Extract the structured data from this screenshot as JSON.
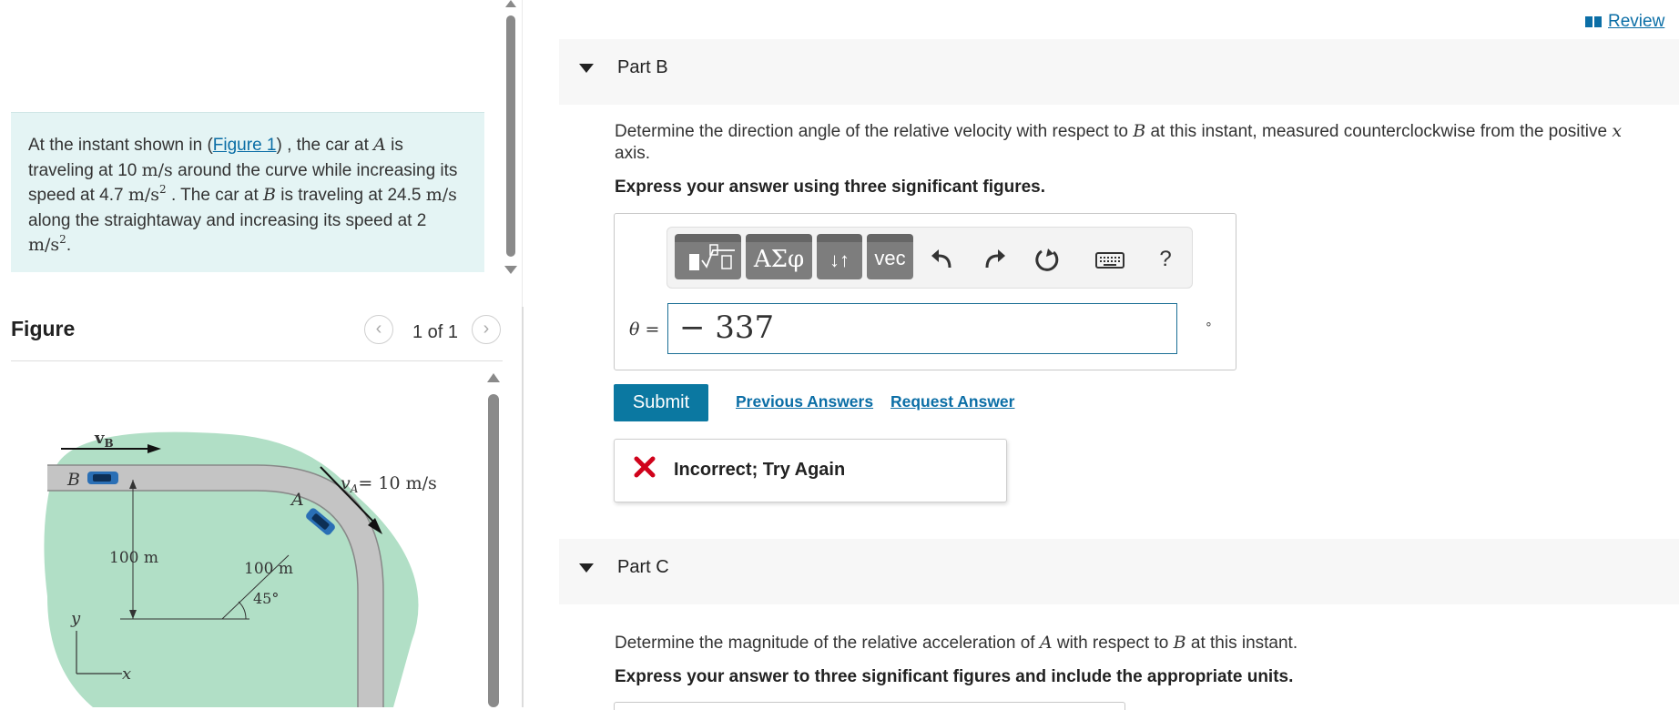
{
  "problem": {
    "seg1": "At the instant shown in (",
    "figure_link": "Figure 1",
    "seg2": ") , the car at ",
    "A": "A",
    "seg3": " is traveling at 10 ",
    "unit_ms": "m/s",
    "seg4": " around the curve while increasing its speed at 4.7 ",
    "unit_ms2": "m/s",
    "exp2": "2",
    "seg5": " . The car at ",
    "B": "B",
    "seg6": " is traveling at 24.5 ",
    "seg7": " along the straightaway and increasing its speed at 2 ",
    "seg8": "."
  },
  "figure": {
    "title": "Figure",
    "counter": "1 of 1",
    "prev_icon": "chevron-left-icon",
    "next_icon": "chevron-right-icon",
    "labels": {
      "vB": "v",
      "vB_sub": "B",
      "B": "B",
      "A": "A",
      "vA_eq": "v",
      "vA_sub": "A",
      "vA_value": "= 10 m/s",
      "dist1": "100 m",
      "dist2": "100 m",
      "angle": "45°",
      "y_axis": "y",
      "x_axis": "x"
    },
    "colors": {
      "shade": "#a8dcc0",
      "road": "#cfcfcf",
      "car": "#2a6fb5"
    }
  },
  "header": {
    "review_label": "Review",
    "review_icon": "book-icon"
  },
  "partB": {
    "title": "Part B",
    "question_pre": "Determine the direction angle of the relative velocity with respect to ",
    "question_B": "B",
    "question_post": " at this instant, measured counterclockwise from the positive ",
    "question_x": "x",
    "question_end": "axis.",
    "instruction": "Express your answer using three significant figures.",
    "toolbar": {
      "greek_label": "ΑΣφ",
      "arrows_label": "↓↑",
      "vec_label": "vec",
      "help_label": "?"
    },
    "theta_label": "θ =",
    "answer_value": "− 337",
    "unit_mark": "∘",
    "submit_label": "Submit",
    "previous_answers_label": "Previous Answers",
    "request_answer_label": "Request Answer",
    "feedback_text": "Incorrect; Try Again"
  },
  "partC": {
    "title": "Part C",
    "question_pre": "Determine the magnitude of the relative acceleration of ",
    "question_A": "A",
    "question_mid": " with respect to ",
    "question_B": "B",
    "question_post": " at this instant.",
    "instruction": "Express your answer to three significant figures and include the appropriate units."
  },
  "colors": {
    "accent": "#0b78a1",
    "link": "#0b6ea6",
    "problem_bg": "#e4f4f4",
    "error": "#d0021b"
  }
}
